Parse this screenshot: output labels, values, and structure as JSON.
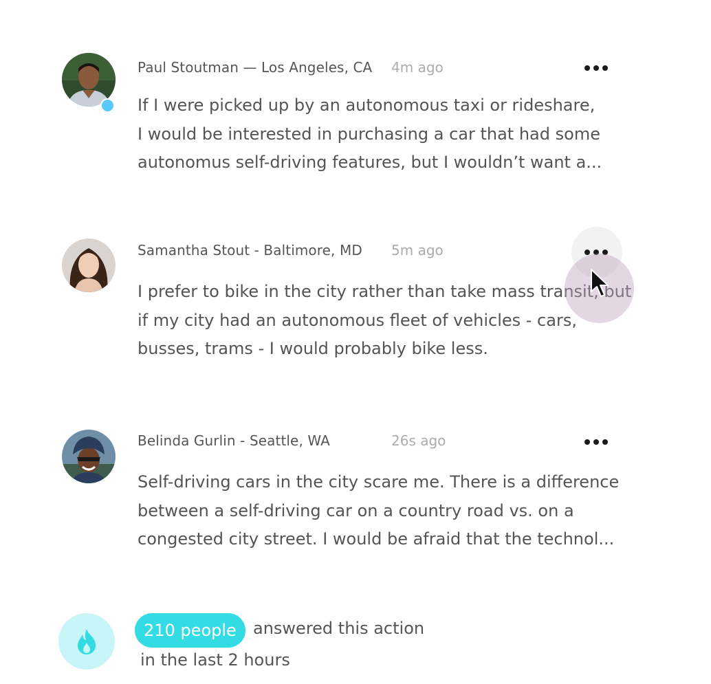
{
  "comments": [
    {
      "author": "Paul Stoutman — Los Angeles, CA",
      "time": "4m ago",
      "online": true,
      "lines": [
        "If I were picked up by an autonomous taxi or rideshare,",
        "I would be interested in purchasing a car that had some",
        "autonomus self-driving features, but I wouldn’t want a..."
      ]
    },
    {
      "author": "Samantha Stout - Baltimore, MD",
      "time": "5m ago",
      "online": false,
      "lines": [
        "I prefer to bike in the city rather than take mass transit, but",
        "if my city had an autonomous fleet of vehicles - cars,",
        "busses, trams - I would probably bike less."
      ]
    },
    {
      "author": "Belinda Gurlin - Seattle, WA",
      "time": "26s ago",
      "online": false,
      "lines": [
        "Self-driving cars in the city scare me. There is a difference",
        "between a self-driving car on a country road vs. on a",
        "congested city street. I would be afraid that the technol..."
      ]
    }
  ],
  "stats": {
    "count_label": "210 people",
    "answered_text": "answered this action",
    "timeframe_text": "in the last 2 hours",
    "icon": "flame-icon"
  },
  "colors": {
    "accent": "#33dbe3",
    "accent_light": "#c8f6f8",
    "online": "#5ac8fa",
    "muted_text": "#ababab",
    "body_text": "#545454"
  }
}
